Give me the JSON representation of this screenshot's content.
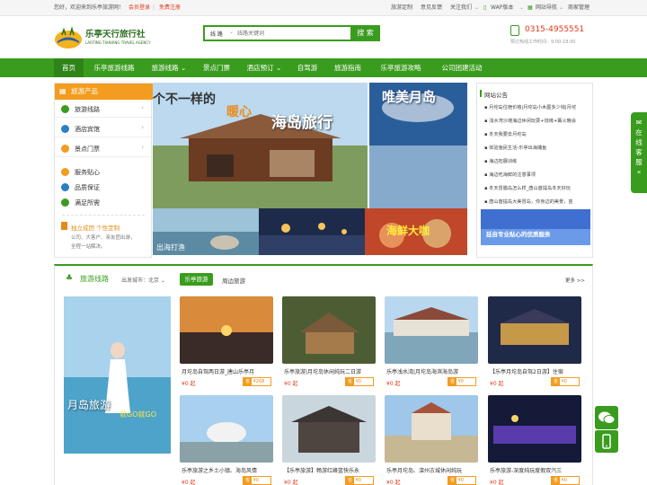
{
  "topbar": {
    "welcome": "您好，欢迎来到乐亭旅游网！",
    "login": "会员登录",
    "register": "免费注册",
    "links": [
      "旅游定制",
      "意见反馈",
      "关注我们",
      "WAP版本",
      "网站导航",
      "商家管理"
    ]
  },
  "header": {
    "logo_title": "乐亭天行旅行社",
    "logo_sub": "LAOTING TIANXING TRAVEL AGENCY",
    "search_category": "线 路",
    "search_placeholder": "线路关键词",
    "search_button": "搜 索",
    "phone": "0315-4955551",
    "hours": "预订热线工作时间：9:00-18:00"
  },
  "nav": [
    "首页",
    "乐亭旅游线路",
    "旅游线路",
    "景点门票",
    "酒店预订",
    "自驾游",
    "旅游指南",
    "乐亭旅游攻略",
    "公司团建活动"
  ],
  "menu": {
    "header": "旅游产品",
    "items": [
      "旅游线路",
      "酒店宾馆",
      "景点门票",
      "服务贴心",
      "品质保证",
      "满足所需"
    ],
    "promo_title": "独立成团 个性定制",
    "promo_text1": "公司、大客户、亲友团出游，",
    "promo_text2": "全程一站解决。"
  },
  "banner": {
    "caption_left": "个不一样的",
    "caption_heart": "暖心",
    "caption_main": "海岛旅行",
    "caption_right": "唯美月岛",
    "sub1_text": "出海打渔",
    "sub2_text": "",
    "sub3_text": "海鲜大咖"
  },
  "notice": {
    "title": "网站公告",
    "items": [
      "月坨岛住宿价格|月坨岛小木屋多少钱|月坨",
      "浅水湾沙滩海边休闲玩耍+烧烤+篝火晚会",
      "冬天我要去月坨岛",
      "体验渔民生活-乐亭出海捕鱼",
      "海边拓展训练",
      "海边吃海鲜的注意事项",
      "冬天冒腊岛怎么样_唐山菩提岛冬天好玩",
      "唐山菩提岛大美冒岛，你身边的美景，苗"
    ],
    "img_text": "延自专业贴心的优质服务"
  },
  "section": {
    "title": "旅游线路",
    "departure": "出发城市：北京",
    "tab_active": "乐亭旅游",
    "tab_other": "周边旅游",
    "more": "更多 >>",
    "bigpic_text1": "月岛旅游",
    "bigpic_text2": "就GO就GO"
  },
  "products": [
    {
      "title": "月坨岛自驾两日游_唐山乐亭月",
      "price": "¥0 起",
      "tag_label": "省",
      "tag_value": "¥268"
    },
    {
      "title": "乐亭旅游|月坨岛休闲纯玩二日游",
      "price": "¥0 起",
      "tag_label": "省",
      "tag_value": "¥0"
    },
    {
      "title": "乐亭浅水湾|月坨岛海滨海岛游",
      "price": "¥0 起",
      "tag_label": "省",
      "tag_value": "¥0"
    },
    {
      "title": "【乐亭月坨岛自驾2日游】住宿",
      "price": "¥0 起",
      "tag_label": "省",
      "tag_value": "¥0"
    },
    {
      "title": "乐亭旅游之乡土小镇、海岛风情",
      "price": "¥0 起",
      "tag_label": "省",
      "tag_value": "¥0"
    },
    {
      "title": "【乐亭旅游】畅游红峰篮快乐永",
      "price": "¥0 起",
      "tag_label": "省",
      "tag_value": "¥0"
    },
    {
      "title": "乐亭月坨岛、滦州古城休闲纯玩",
      "price": "¥0 起",
      "tag_label": "省",
      "tag_value": "¥0"
    },
    {
      "title": "乐亭旅游-深度纯玩度假双汽三",
      "price": "¥0 起",
      "tag_label": "省",
      "tag_value": "¥0"
    }
  ],
  "float": {
    "kefu": "在线客服"
  },
  "colors": {
    "brand_green": "#3a9c1e",
    "accent_orange": "#f39c1f",
    "price_red": "#e0391c"
  }
}
